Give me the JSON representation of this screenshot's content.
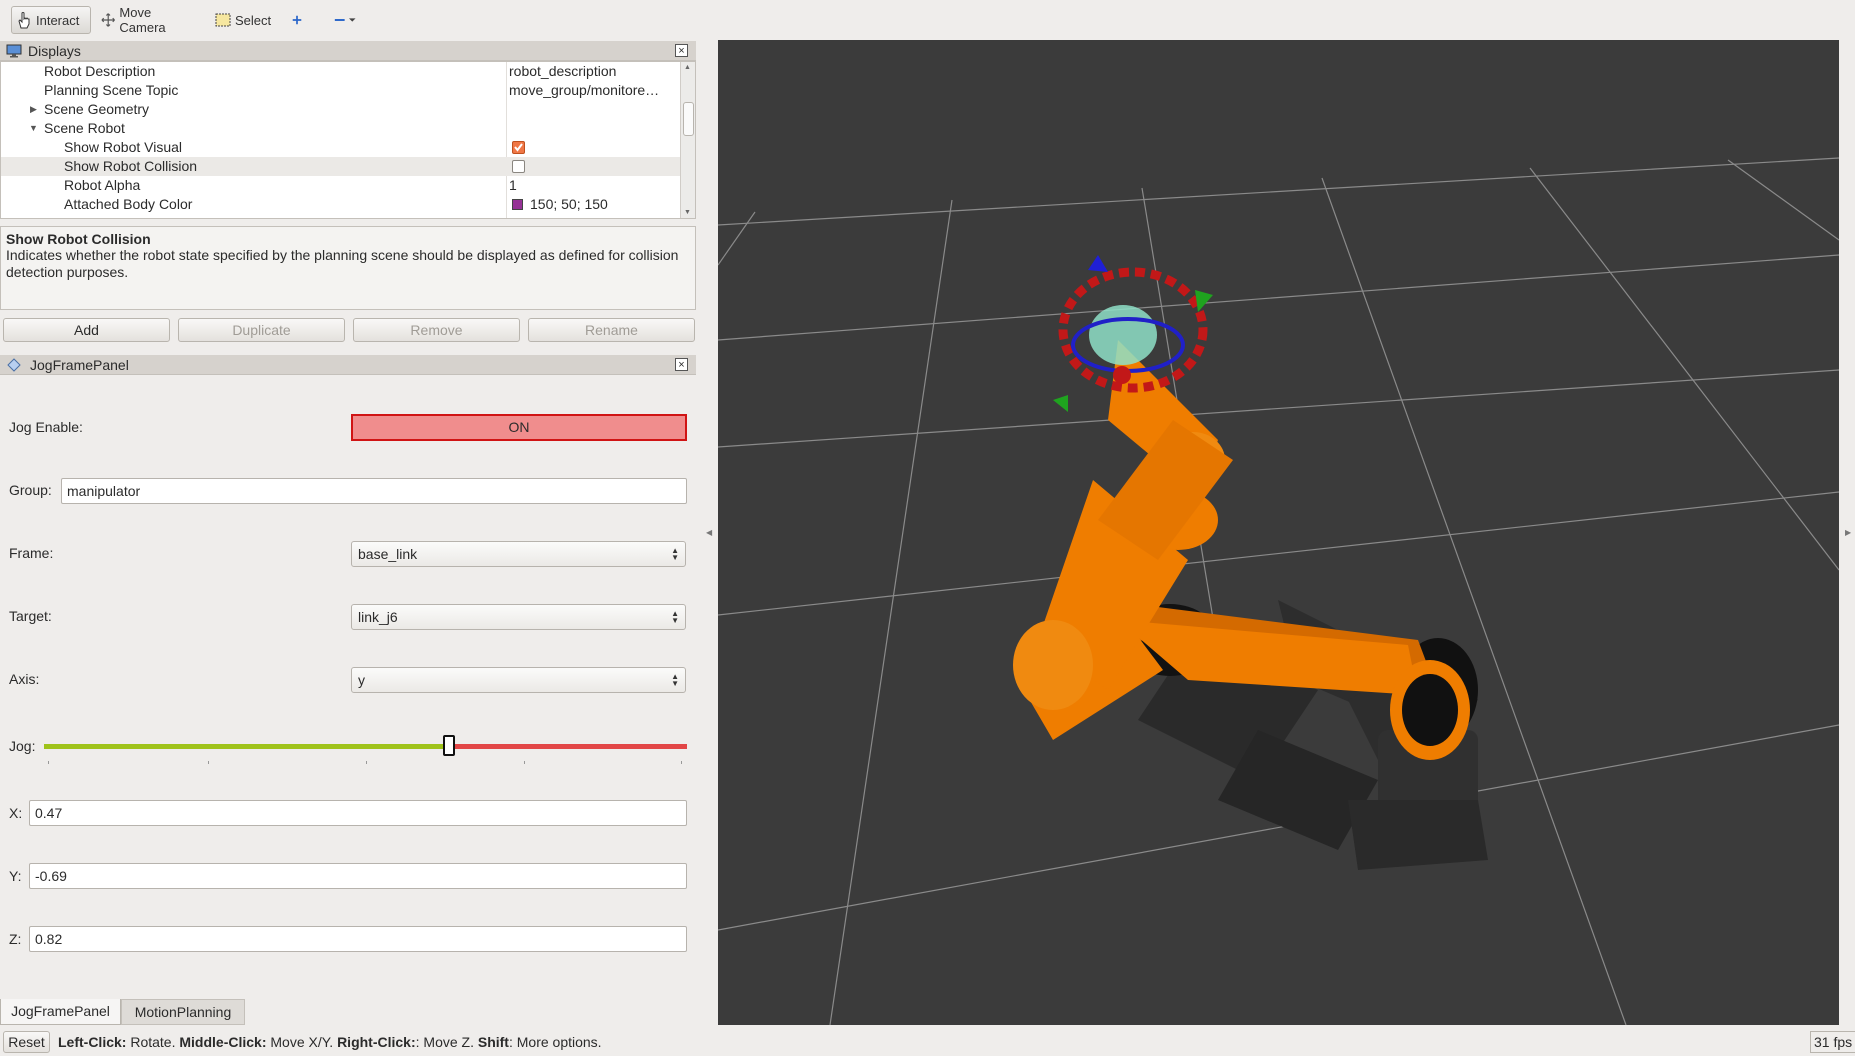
{
  "toolbar": {
    "interact": "Interact",
    "move_camera": "Move Camera",
    "select": "Select"
  },
  "displays": {
    "title": "Displays",
    "rows": [
      {
        "label": "Robot Description",
        "value": "robot_description"
      },
      {
        "label": "Planning Scene Topic",
        "value": "move_group/monitore…"
      },
      {
        "label": "Scene Geometry",
        "value": ""
      },
      {
        "label": "Scene Robot",
        "value": ""
      },
      {
        "label": "Show Robot Visual",
        "checked": true
      },
      {
        "label": "Show Robot Collision",
        "checked": false
      },
      {
        "label": "Robot Alpha",
        "value": "1"
      },
      {
        "label": "Attached Body Color",
        "value": "150; 50; 150",
        "swatch": "#963296"
      }
    ],
    "description_title": "Show Robot Collision",
    "description_text": "Indicates whether the robot state specified by the planning scene should be displayed as defined for collision detection purposes.",
    "buttons": {
      "add": "Add",
      "duplicate": "Duplicate",
      "remove": "Remove",
      "rename": "Rename"
    }
  },
  "jog_panel": {
    "title": "JogFramePanel",
    "jog_enable_label": "Jog Enable:",
    "jog_enable_value": "ON",
    "group_label": "Group:",
    "group_value": "manipulator",
    "frame_label": "Frame:",
    "frame_value": "base_link",
    "target_label": "Target:",
    "target_value": "link_j6",
    "axis_label": "Axis:",
    "axis_value": "y",
    "jog_label": "Jog:",
    "jog_position": 0.63,
    "x_label": "X:",
    "x_value": "0.47",
    "y_label": "Y:",
    "y_value": "-0.69",
    "z_label": "Z:",
    "z_value": "0.82"
  },
  "tabs": [
    "JogFramePanel",
    "MotionPlanning"
  ],
  "statusbar": {
    "reset": "Reset",
    "left_click": "Left-Click:",
    "left_action": " Rotate. ",
    "middle_click": "Middle-Click:",
    "middle_action": " Move X/Y. ",
    "right_click": "Right-Click:",
    "right_action": ": Move Z. ",
    "shift": "Shift",
    "shift_action": ": More options.",
    "fps": "31 fps"
  },
  "colors": {
    "on_button_bg": "#f08d8d",
    "on_button_border": "#d01414",
    "slider_left": "#9fc31a",
    "slider_right": "#e24646",
    "robot_orange": "#ef7d00",
    "viewport_bg": "#3b3b3b"
  }
}
